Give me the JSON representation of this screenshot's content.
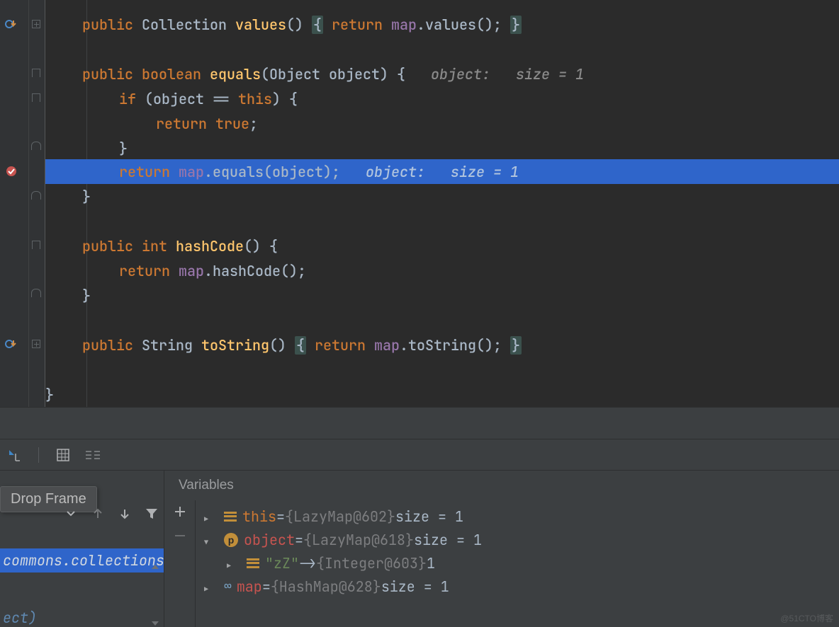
{
  "editor": {
    "lines": {
      "l1_kw": "public",
      "l1_ty": " Collection ",
      "l1_m": "values",
      "l1_rest1": "() ",
      "l1_ob": "{",
      "l1_ret": " return ",
      "l1_f": "map",
      "l1_rest2": ".values(); ",
      "l1_cb": "}",
      "l3_kw": "public",
      "l3_bool": " boolean ",
      "l3_m": "equals",
      "l3_args": "(Object object) {",
      "l3_hint": "   object:   size = 1",
      "l4_if": "if",
      "l4_cond1": " (object == ",
      "l4_this": "this",
      "l4_cond2": ") {",
      "l5_ret": "return ",
      "l5_true": "true",
      "l5_semi": ";",
      "l6_cb": "}",
      "l7_ret": "return ",
      "l7_f": "map",
      "l7_rest": ".equals(object);",
      "l7_hint": "   object:   size = 1",
      "l8_cb": "}",
      "l10_kw": "public",
      "l10_int": " int ",
      "l10_m": "hashCode",
      "l10_rest": "() {",
      "l11_ret": "return ",
      "l11_f": "map",
      "l11_rest": ".hashCode();",
      "l12_cb": "}",
      "l14_kw": "public",
      "l14_ty": " String ",
      "l14_m": "toString",
      "l14_rest1": "() ",
      "l14_ob": "{",
      "l14_ret": " return ",
      "l14_f": "map",
      "l14_rest2": ".toString(); ",
      "l14_cb": "}",
      "l16_cb": "}"
    }
  },
  "debug": {
    "tooltip": "Drop Frame",
    "frame_selected": "commons.collections.m",
    "frame_below": "ect)",
    "vars_title": "Variables",
    "rows": {
      "r1_name": "this",
      "r1_eq": " = ",
      "r1_obj": "{LazyMap@602}",
      "r1_extra": "  size = 1",
      "r2_name": "object",
      "r2_eq": " = ",
      "r2_obj": "{LazyMap@618}",
      "r2_extra": "  size = 1",
      "r3_key": "\"zZ\"",
      "r3_arr": " -> ",
      "r3_obj": "{Integer@603}",
      "r3_extra": " 1",
      "r4_name": "map",
      "r4_eq": " = ",
      "r4_obj": "{HashMap@628}",
      "r4_extra": "  size = 1"
    }
  },
  "watermark": "@51CTO博客"
}
